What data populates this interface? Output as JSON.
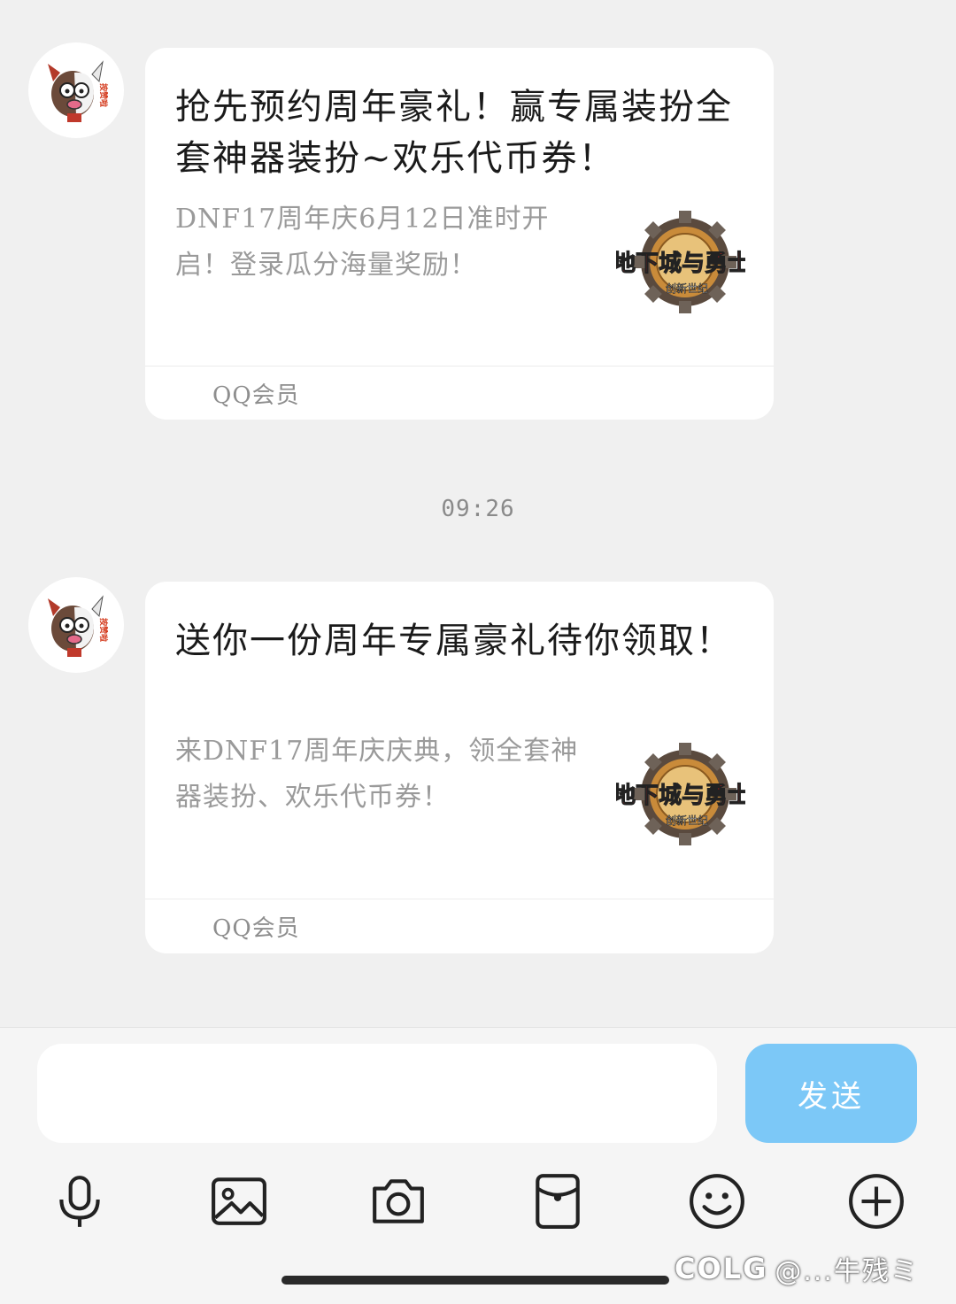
{
  "messages": [
    {
      "title": "抢先预约周年豪礼！赢专属装扮全套神器装扮~欢乐代币券！",
      "description": "DNF17周年庆6月12日准时开启！登录瓜分海量奖励！",
      "logo_text": "地下城与勇士",
      "logo_sub": "创新世纪",
      "source": "QQ会员"
    },
    {
      "title": "送你一份周年专属豪礼待你领取！",
      "description": "来DNF17周年庆庆典，领全套神器装扮、欢乐代币券！",
      "logo_text": "地下城与勇士",
      "logo_sub": "创新世纪",
      "source": "QQ会员"
    }
  ],
  "timestamp": "09:26",
  "avatar_text": "按赞啦！",
  "composer": {
    "input_value": "",
    "send_label": "发送"
  },
  "toolbar": [
    "microphone-icon",
    "image-icon",
    "camera-icon",
    "red-packet-icon",
    "emoji-icon",
    "plus-icon"
  ],
  "watermark": {
    "logo": "COLG",
    "user": "@...牛残ミ"
  },
  "colors": {
    "background": "#f0f0f0",
    "card": "#ffffff",
    "send_button": "#7cc8f7",
    "secondary_text": "#9a9a9a"
  }
}
